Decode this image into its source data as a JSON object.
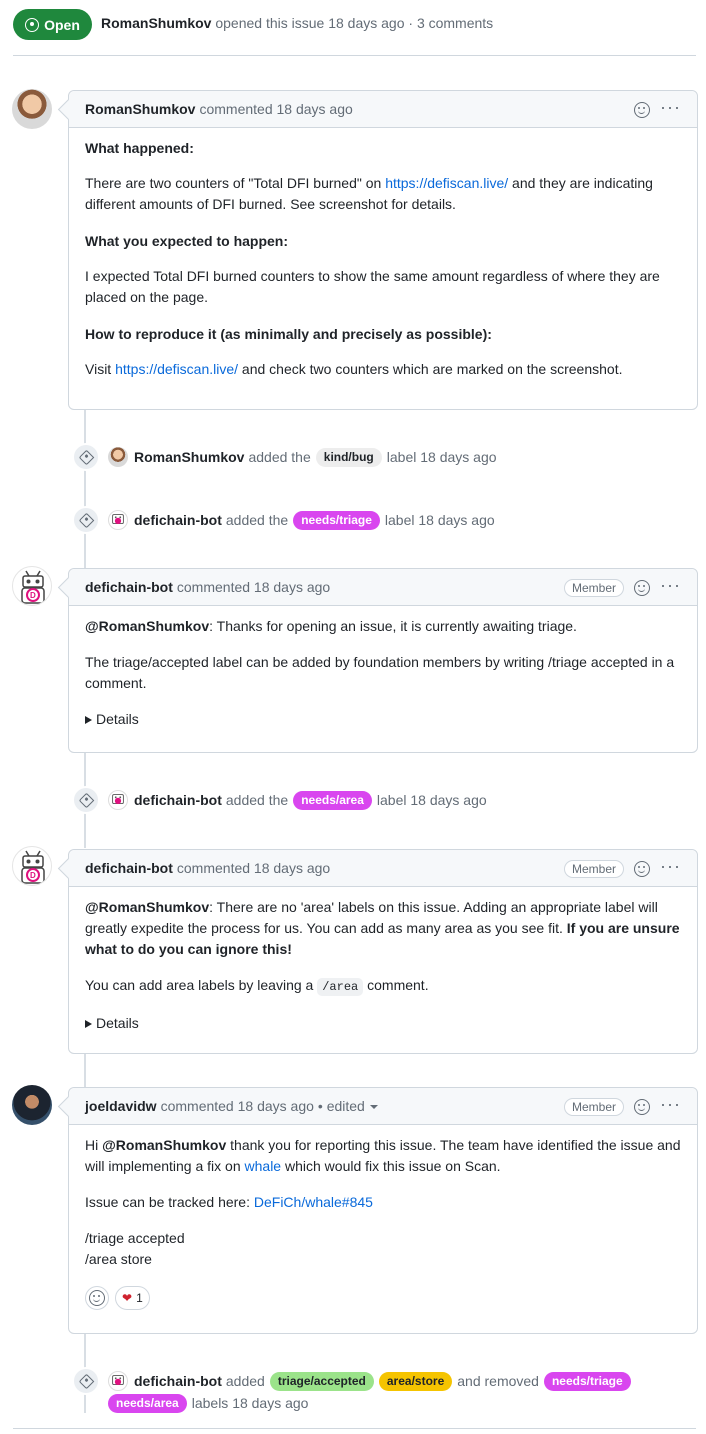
{
  "header": {
    "status": "Open",
    "author": "RomanShumkov",
    "meta_text": "opened this issue 18 days ago · 3 comments"
  },
  "comment1": {
    "author": "RomanShumkov",
    "time": "commented 18 days ago",
    "h1": "What happened:",
    "p1_before": "There are two counters of \"Total DFI burned\" on ",
    "p1_link": "https://defiscan.live/",
    "p1_after": " and they are indicating different amounts of DFI burned. See screenshot for details.",
    "h2": "What you expected to happen:",
    "p2": "I expected Total DFI burned counters to show the same amount regardless of where they are placed on the page.",
    "h3": "How to reproduce it (as minimally and precisely as possible):",
    "p3_before": "Visit ",
    "p3_link": "https://defiscan.live/",
    "p3_after": " and check two counters which are marked on the screenshot."
  },
  "event1": {
    "author": "RomanShumkov",
    "added": "added the",
    "label": "kind/bug",
    "after": "label 18 days ago"
  },
  "event2": {
    "author": "defichain-bot",
    "added": "added the",
    "label": "needs/triage",
    "after": "label 18 days ago"
  },
  "comment2": {
    "author": "defichain-bot",
    "time": "commented 18 days ago",
    "badge": "Member",
    "mention": "@RomanShumkov",
    "p1": ": Thanks for opening an issue, it is currently awaiting triage.",
    "p2": "The triage/accepted label can be added by foundation members by writing /triage accepted in a comment.",
    "details": "Details"
  },
  "event3": {
    "author": "defichain-bot",
    "added": "added the",
    "label": "needs/area",
    "after": "label 18 days ago"
  },
  "comment3": {
    "author": "defichain-bot",
    "time": "commented 18 days ago",
    "badge": "Member",
    "mention": "@RomanShumkov",
    "p1": ": There are no 'area' labels on this issue. Adding an appropriate label will greatly expedite the process for us. You can add as many area as you see fit. ",
    "p1_bold": "If you are unsure what to do you can ignore this!",
    "p2_before": "You can add area labels by leaving a ",
    "p2_code": "/area",
    "p2_after": " comment.",
    "details": "Details"
  },
  "comment4": {
    "author": "joeldavidw",
    "time": "commented 18 days ago",
    "edited": "• edited",
    "badge": "Member",
    "p1_hi": "Hi ",
    "p1_mention": "@RomanShumkov",
    "p1_mid": " thank you for reporting this issue. The team have identified the issue and will implementing a fix on ",
    "p1_link": "whale",
    "p1_after": " which would fix this issue on Scan.",
    "p2_before": "Issue can be tracked here: ",
    "p2_link": "DeFiCh/whale#845",
    "p3_line1": "/triage accepted",
    "p3_line2": "/area store",
    "reaction_count": "1"
  },
  "event4": {
    "author": "defichain-bot",
    "added": "added",
    "label1": "triage/accepted",
    "label2": "area/store",
    "removed": "and removed",
    "label3": "needs/triage",
    "label4": "needs/area",
    "after": "labels 18 days ago"
  },
  "colors": {
    "open_green": "#1f883d",
    "label_purple": "#d946ef",
    "label_green": "#9be38a",
    "label_yellow": "#f5c400",
    "link": "#0969da"
  }
}
